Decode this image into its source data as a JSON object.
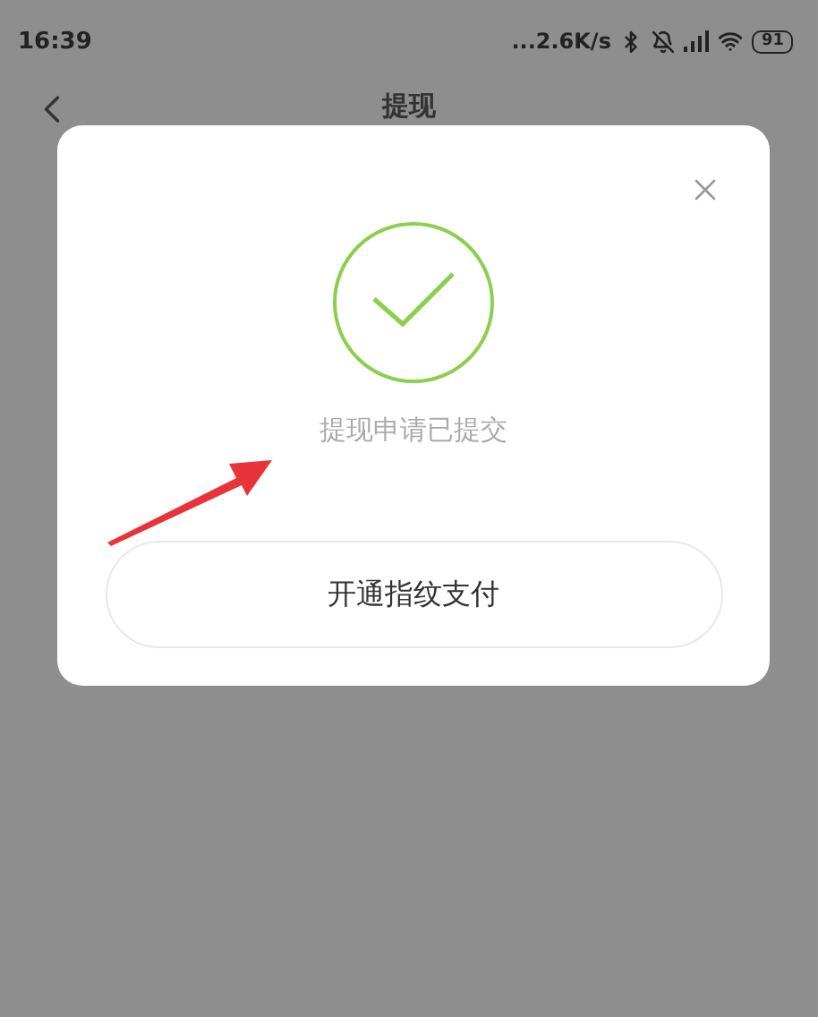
{
  "status_bar": {
    "time": "16:39",
    "network_speed": "...2.6K/s",
    "battery": "91"
  },
  "nav": {
    "title": "提现"
  },
  "dialog": {
    "message": "提现申请已提交",
    "button": "开通指纹支付"
  }
}
